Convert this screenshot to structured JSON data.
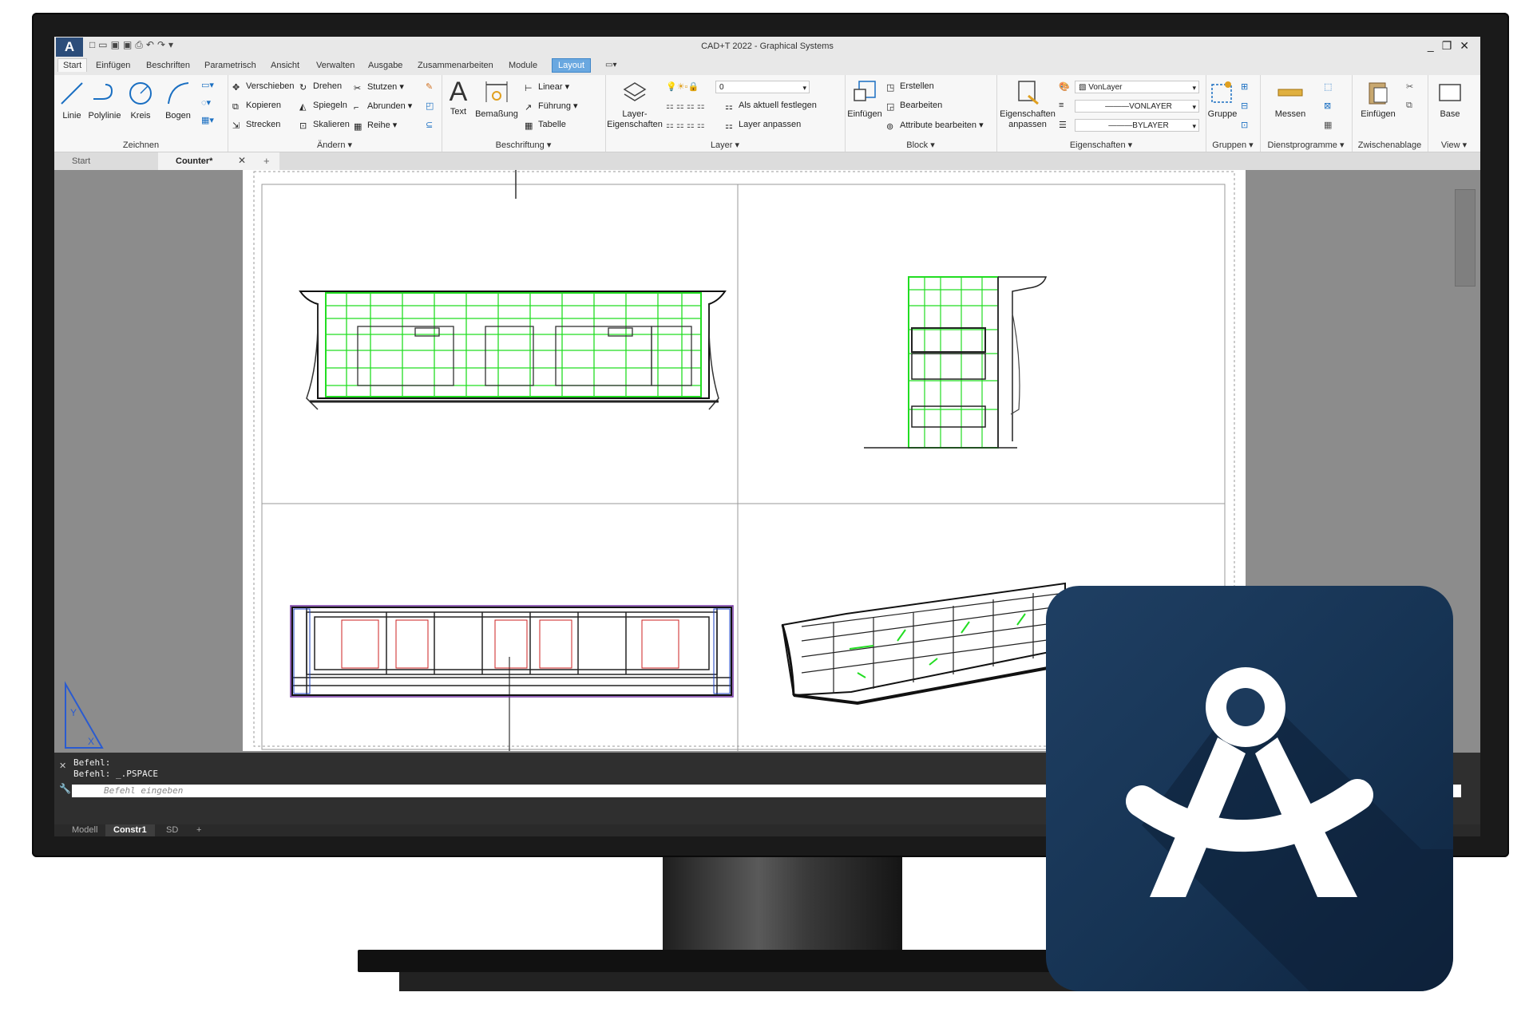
{
  "window": {
    "title": "CAD+T 2022 - Graphical Systems",
    "app_button": "A",
    "controls": [
      "_",
      "❐",
      "✕"
    ]
  },
  "menu_tabs": [
    "Start",
    "Einfügen",
    "Beschriften",
    "Parametrisch",
    "Ansicht",
    "Verwalten",
    "Ausgabe",
    "Zusammenarbeiten",
    "Module",
    "Layout"
  ],
  "active_tab": "Start",
  "ribbon": {
    "zeichnen": {
      "label": "Zeichnen",
      "items": [
        "Linie",
        "Polylinie",
        "Kreis",
        "Bogen"
      ]
    },
    "aendern": {
      "label": "Ändern",
      "items": [
        "Verschieben",
        "Drehen",
        "Stutzen",
        "Kopieren",
        "Spiegeln",
        "Abrunden",
        "Strecken",
        "Skalieren",
        "Reihe"
      ]
    },
    "beschriftung": {
      "label": "Beschriftung",
      "big": [
        "Text",
        "Bemaßung"
      ],
      "items": [
        "Linear",
        "Führung",
        "Tabelle"
      ]
    },
    "layer": {
      "label": "Layer",
      "big": "Layer-\nEigenschaften",
      "current": "0",
      "items": [
        "Als aktuell festlegen",
        "Layer anpassen"
      ]
    },
    "block": {
      "label": "Block",
      "big": "Einfügen",
      "items": [
        "Erstellen",
        "Bearbeiten",
        "Attribute bearbeiten"
      ]
    },
    "eigenschaften": {
      "label": "Eigenschaften",
      "big": "Eigenschaften\nanpassen",
      "color": "VonLayer",
      "linetype": "VONLAYER",
      "lineweight": "BYLAYER"
    },
    "gruppen": {
      "label": "Gruppen",
      "big": "Gruppe"
    },
    "dienst": {
      "label": "Dienstprogramme",
      "big": "Messen"
    },
    "zwischen": {
      "label": "Zwischenablage",
      "big": "Einfügen"
    },
    "view": {
      "label": "View",
      "big": "Base"
    }
  },
  "doc_tabs": [
    "Start",
    "Counter*"
  ],
  "command": {
    "history": [
      "Befehl:",
      "Befehl: _.PSPACE"
    ],
    "placeholder": "Befehl eingeben"
  },
  "layout_tabs": [
    "Modell",
    "Constr1",
    "SD"
  ],
  "active_layout": "Constr1",
  "colors": {
    "accent": "#2c4d7a",
    "layout_tab": "#6aa8e0",
    "green_lines": "#22dd22",
    "logo_bg": "#1a3a5c"
  }
}
